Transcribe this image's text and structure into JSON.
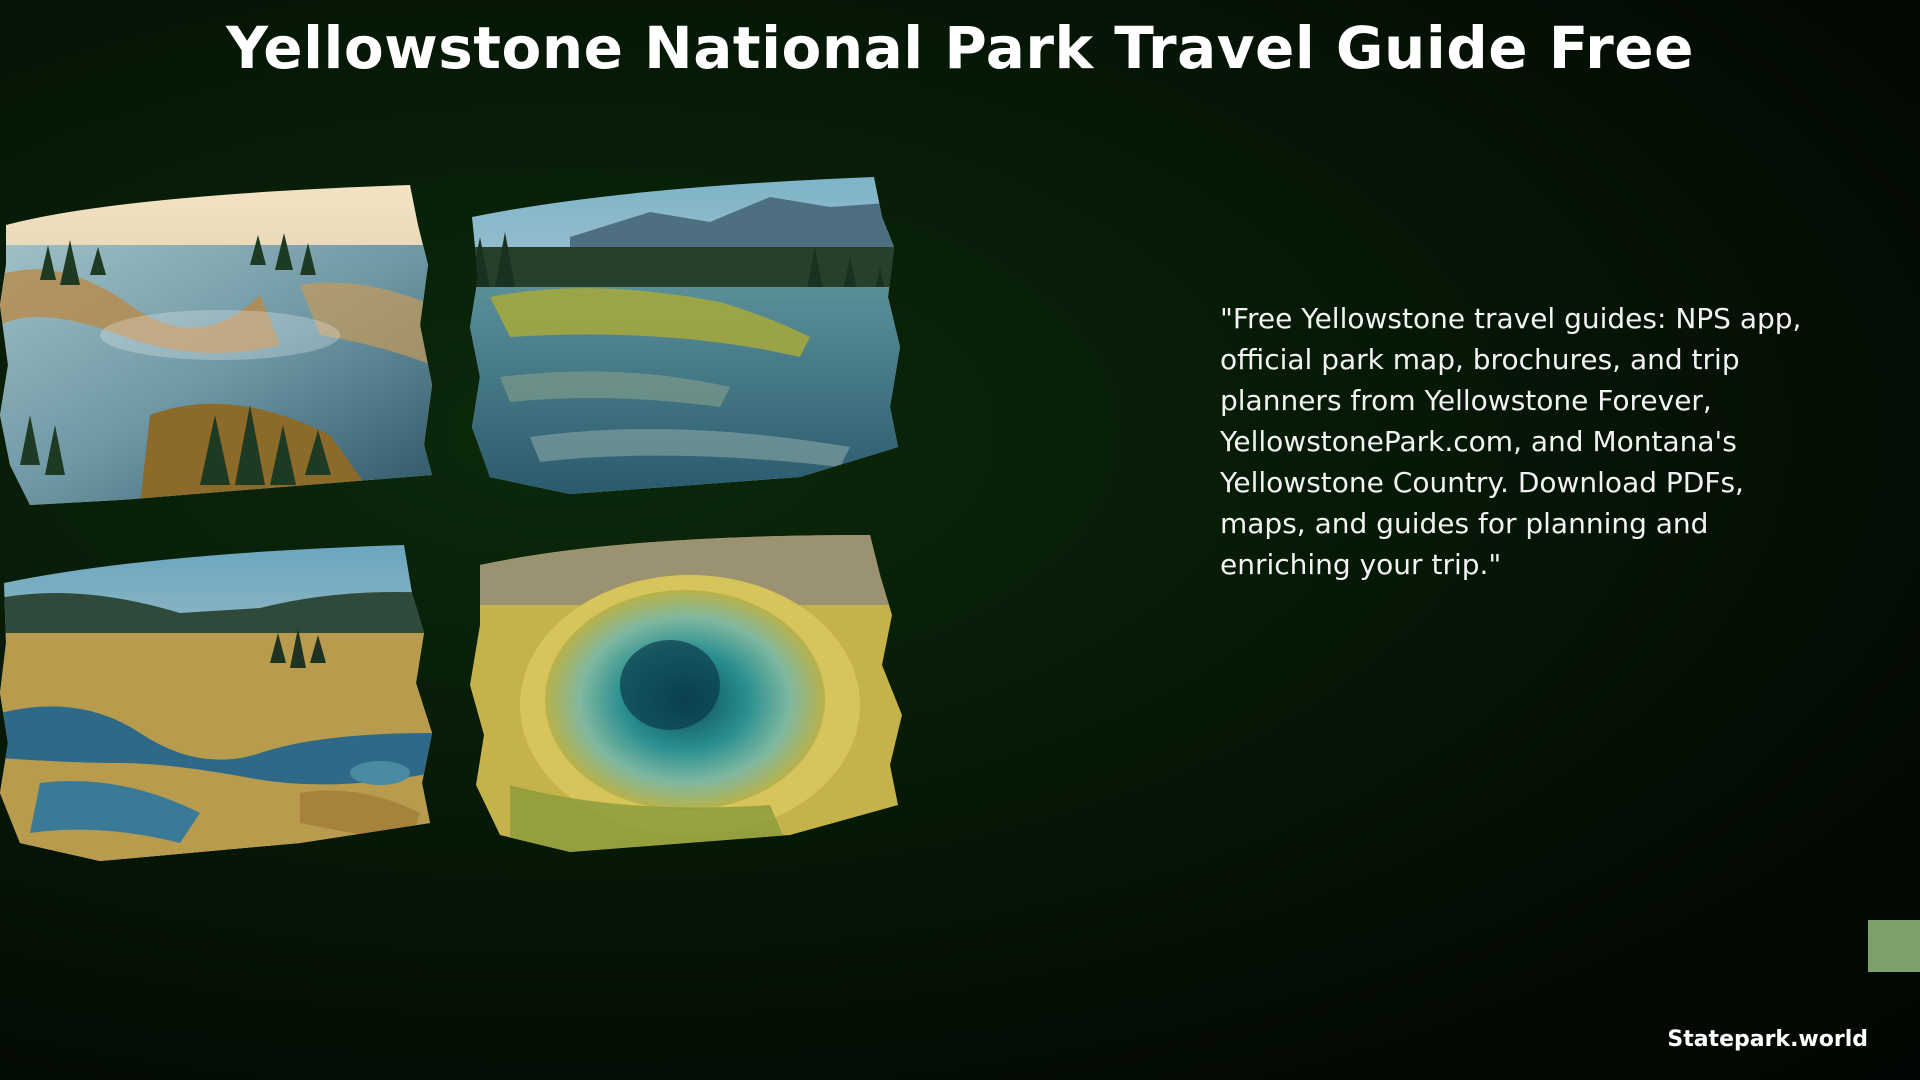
{
  "page": {
    "title": "Yellowstone National Park Travel Guide Free",
    "description": "\"Free Yellowstone travel guides: NPS app, official park map, brochures, and trip planners from Yellowstone Forever, YellowstonePark.com, and Montana's Yellowstone Country. Download PDFs, maps, and guides for planning and enriching your trip.\"",
    "footer_brand": "Statepark.world"
  },
  "colors": {
    "background": "#061806",
    "accent_square": "#7ea06a",
    "text": "#ffffff"
  },
  "images": [
    {
      "name": "photo-misty-river-forest",
      "subject": "aerial view of misty river winding through pine forest"
    },
    {
      "name": "photo-mountain-lake-marsh",
      "subject": "mountain lake with marshy wetland and pine trees"
    },
    {
      "name": "photo-valley-wetland",
      "subject": "golden valley wetland with meandering streams"
    },
    {
      "name": "photo-hot-spring",
      "subject": "aerial view of turquoise hot spring with yellow mineral rim"
    }
  ]
}
